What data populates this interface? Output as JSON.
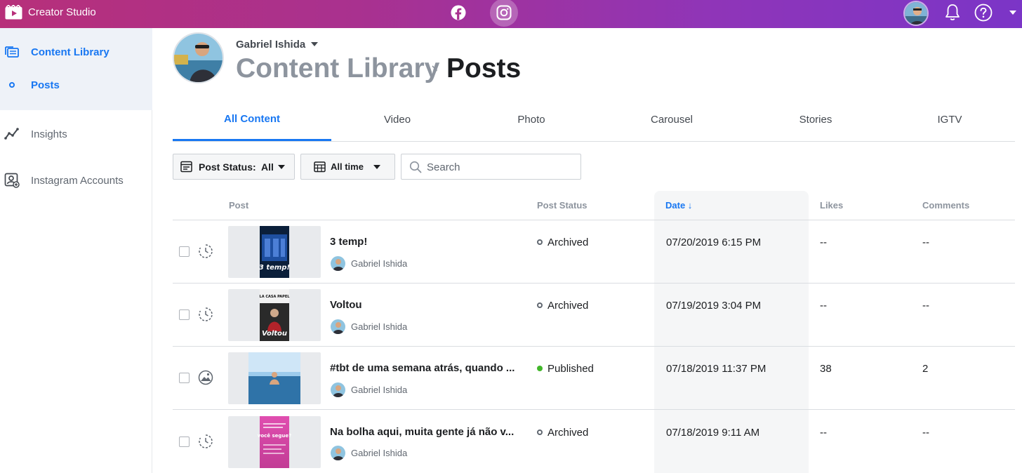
{
  "app": {
    "title": "Creator Studio"
  },
  "topbar": {
    "platforms": [
      "facebook-icon",
      "instagram-icon"
    ],
    "active_platform": "instagram-icon"
  },
  "sidebar": {
    "items": [
      {
        "label": "Content Library",
        "icon": "content-library-icon",
        "active": true
      },
      {
        "label": "Posts",
        "icon": "dot-icon",
        "active": true
      },
      {
        "label": "Insights",
        "icon": "insights-icon",
        "active": false
      },
      {
        "label": "Instagram Accounts",
        "icon": "instagram-accounts-icon",
        "active": false
      }
    ]
  },
  "header": {
    "account_name": "Gabriel Ishida",
    "breadcrumb_parent": "Content Library",
    "breadcrumb_current": "Posts"
  },
  "tabs": [
    {
      "label": "All Content",
      "active": true
    },
    {
      "label": "Video",
      "active": false
    },
    {
      "label": "Photo",
      "active": false
    },
    {
      "label": "Carousel",
      "active": false
    },
    {
      "label": "Stories",
      "active": false
    },
    {
      "label": "IGTV",
      "active": false
    }
  ],
  "filters": {
    "status_label": "Post Status:",
    "status_value": "All",
    "time_value": "All time",
    "search_placeholder": "Search"
  },
  "table": {
    "columns": [
      "Post",
      "Post Status",
      "Date ↓",
      "Likes",
      "Comments"
    ],
    "sorted_column": "Date ↓",
    "rows": [
      {
        "title": "3 temp!",
        "author": "Gabriel Ishida",
        "status": "Archived",
        "date": "07/20/2019 6:15 PM",
        "likes": "--",
        "comments": "--",
        "type_icon": "story-icon",
        "thumb_caption": "3 temp!"
      },
      {
        "title": "Voltou",
        "author": "Gabriel Ishida",
        "status": "Archived",
        "date": "07/19/2019 3:04 PM",
        "likes": "--",
        "comments": "--",
        "type_icon": "story-icon",
        "thumb_caption": "Voltou",
        "thumb_header": "LA CASA PAPEL"
      },
      {
        "title": "#tbt de uma semana atrás, quando ...",
        "author": "Gabriel Ishida",
        "status": "Published",
        "date": "07/18/2019 11:37 PM",
        "likes": "38",
        "comments": "2",
        "type_icon": "photo-icon"
      },
      {
        "title": "Na bolha aqui, muita gente já não v...",
        "author": "Gabriel Ishida",
        "status": "Archived",
        "date": "07/18/2019 9:11 AM",
        "likes": "--",
        "comments": "--",
        "type_icon": "story-icon",
        "thumb_caption": "você segue?"
      }
    ]
  },
  "colors": {
    "accent": "#1877f2",
    "published": "#42b72a",
    "topbar_start": "#b7307a",
    "topbar_end": "#7b35c7"
  }
}
